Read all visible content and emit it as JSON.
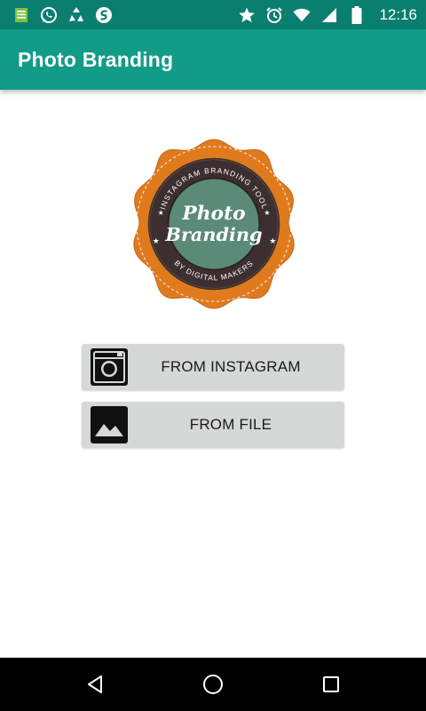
{
  "status_bar": {
    "time": "12:16",
    "left_icons": [
      "notes-icon",
      "whatsapp-icon",
      "recycle-icon",
      "shazam-icon"
    ],
    "right_icons": [
      "star-icon",
      "alarm-icon",
      "wifi-icon",
      "signal-icon",
      "battery-icon"
    ]
  },
  "app_bar": {
    "title": "Photo Branding",
    "color": "#129c88"
  },
  "logo": {
    "ring_text_top": "INSTAGRAM BRANDING TOOL",
    "ring_text_bottom": "BY DIGITAL MAKERS",
    "center_line1": "Photo",
    "center_line2": "Branding",
    "badge_color": "#e07b1d",
    "ring_color": "#3d2f2f",
    "center_color": "#5b8a78"
  },
  "buttons": {
    "instagram_label": "FROM INSTAGRAM",
    "file_label": "FROM FILE"
  },
  "nav_bar": {
    "buttons": [
      "back-icon",
      "home-icon",
      "recents-icon"
    ]
  }
}
